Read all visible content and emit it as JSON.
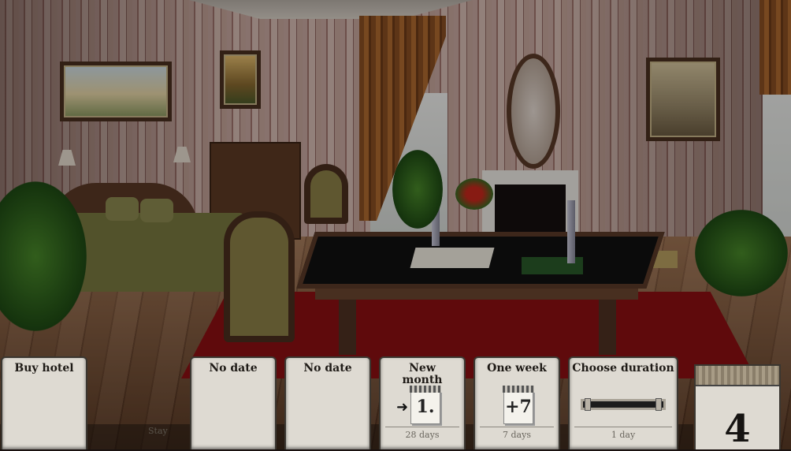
{
  "hud": {
    "buy_hotel": {
      "label": "Buy hotel"
    },
    "slot1": {
      "label": "No date"
    },
    "slot2": {
      "label": "No date"
    },
    "new_month": {
      "label_line1": "New",
      "label_line2": "month",
      "calendar_value": "1.",
      "sub": "28 days"
    },
    "one_week": {
      "label": "One week",
      "calendar_value": "+7",
      "sub": "7 days"
    },
    "choose_duration": {
      "label": "Choose duration",
      "sub": "1 day"
    },
    "stay_label": "Stay",
    "counter_value": "4"
  },
  "icons": [
    "arrow-right-icon",
    "calendar-icon",
    "slider-left-knob-icon",
    "slider-right-knob-icon"
  ]
}
